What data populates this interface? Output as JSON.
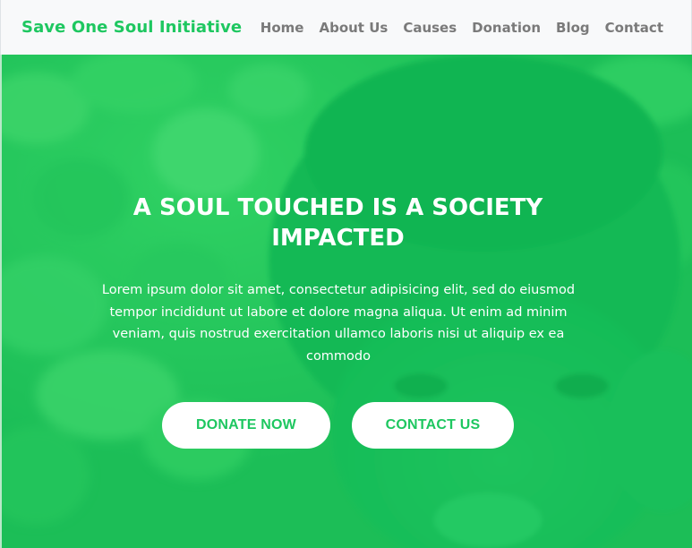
{
  "navbar": {
    "brand": "Save One Soul Initiative",
    "links": [
      {
        "label": "Home"
      },
      {
        "label": "About Us"
      },
      {
        "label": "Causes"
      },
      {
        "label": "Donation"
      },
      {
        "label": "Blog"
      },
      {
        "label": "Contact"
      }
    ]
  },
  "hero": {
    "title": "A SOUL TOUCHED IS A SOCIETY IMPACTED",
    "text": "Lorem ipsum dolor sit amet, consectetur adipisicing elit, sed do eiusmod tempor incididunt ut labore et dolore magna aliqua. Ut enim ad minim veniam, quis nostrud exercitation ullamco laboris nisi ut aliquip ex ea commodo",
    "buttons": {
      "donate": "DONATE NOW",
      "contact": "CONTACT US"
    }
  },
  "colors": {
    "accent": "#1ec760",
    "overlay": "#14cd5f",
    "navbar_bg": "#f8f9fa",
    "nav_link": "#7a7a7a",
    "button_bg": "#ffffff"
  }
}
